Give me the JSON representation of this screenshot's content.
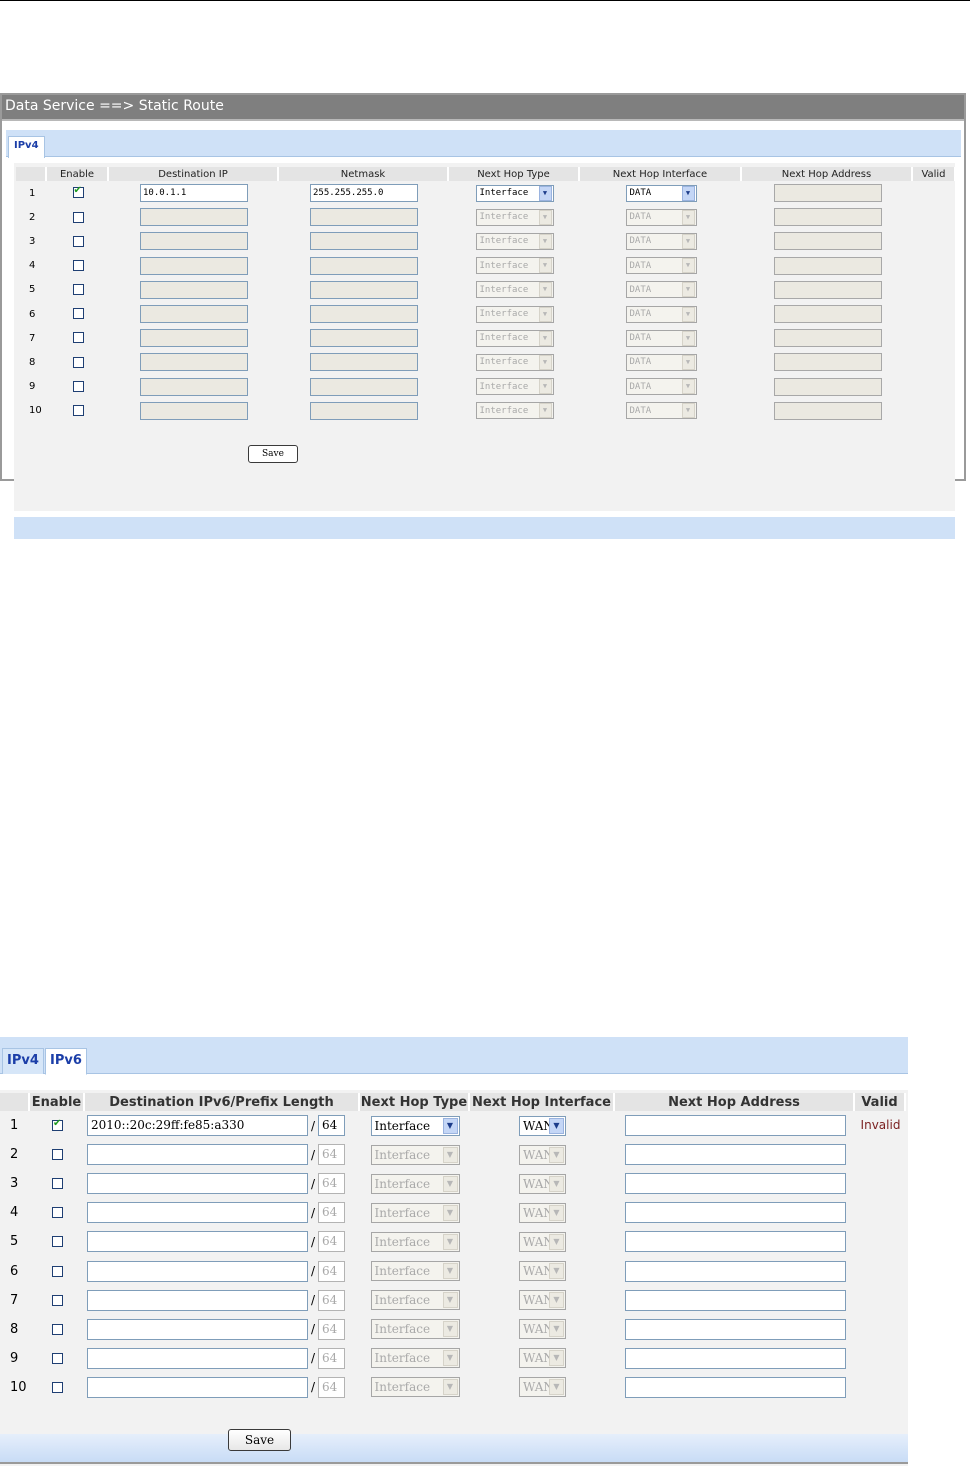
{
  "panel1": {
    "title": "Data Service ==> Static Route",
    "tab_ipv4": "IPv4",
    "headers": {
      "enable": "Enable",
      "dest": "Destination IP",
      "netmask": "Netmask",
      "hop_type": "Next Hop Type",
      "hop_if": "Next Hop Interface",
      "hop_addr": "Next Hop Address",
      "valid": "Valid"
    },
    "rows": [
      {
        "num": "1",
        "enabled": true,
        "dest": "10.0.1.1",
        "netmask": "255.255.255.0",
        "hop_type": "Interface",
        "hop_if": "DATA",
        "hop_addr": "",
        "valid": ""
      },
      {
        "num": "2",
        "enabled": false,
        "dest": "",
        "netmask": "",
        "hop_type": "Interface",
        "hop_if": "DATA",
        "hop_addr": "",
        "valid": ""
      },
      {
        "num": "3",
        "enabled": false,
        "dest": "",
        "netmask": "",
        "hop_type": "Interface",
        "hop_if": "DATA",
        "hop_addr": "",
        "valid": ""
      },
      {
        "num": "4",
        "enabled": false,
        "dest": "",
        "netmask": "",
        "hop_type": "Interface",
        "hop_if": "DATA",
        "hop_addr": "",
        "valid": ""
      },
      {
        "num": "5",
        "enabled": false,
        "dest": "",
        "netmask": "",
        "hop_type": "Interface",
        "hop_if": "DATA",
        "hop_addr": "",
        "valid": ""
      },
      {
        "num": "6",
        "enabled": false,
        "dest": "",
        "netmask": "",
        "hop_type": "Interface",
        "hop_if": "DATA",
        "hop_addr": "",
        "valid": ""
      },
      {
        "num": "7",
        "enabled": false,
        "dest": "",
        "netmask": "",
        "hop_type": "Interface",
        "hop_if": "DATA",
        "hop_addr": "",
        "valid": ""
      },
      {
        "num": "8",
        "enabled": false,
        "dest": "",
        "netmask": "",
        "hop_type": "Interface",
        "hop_if": "DATA",
        "hop_addr": "",
        "valid": ""
      },
      {
        "num": "9",
        "enabled": false,
        "dest": "",
        "netmask": "",
        "hop_type": "Interface",
        "hop_if": "DATA",
        "hop_addr": "",
        "valid": ""
      },
      {
        "num": "10",
        "enabled": false,
        "dest": "",
        "netmask": "",
        "hop_type": "Interface",
        "hop_if": "DATA",
        "hop_addr": "",
        "valid": ""
      }
    ],
    "save_label": "Save"
  },
  "panel2": {
    "tab_ipv4": "IPv4",
    "tab_ipv6": "IPv6",
    "headers": {
      "enable": "Enable",
      "dest": "Destination IPv6/Prefix Length",
      "hop_type": "Next Hop Type",
      "hop_if": "Next Hop Interface",
      "hop_addr": "Next Hop Address",
      "valid": "Valid"
    },
    "rows": [
      {
        "num": "1",
        "enabled": true,
        "dest": "2010::20c:29ff:fe85:a330",
        "prefix": "64",
        "hop_type": "Interface",
        "hop_if": "WAN",
        "hop_addr": "",
        "valid": "Invalid"
      },
      {
        "num": "2",
        "enabled": false,
        "dest": "",
        "prefix": "64",
        "hop_type": "Interface",
        "hop_if": "WAN",
        "hop_addr": "",
        "valid": ""
      },
      {
        "num": "3",
        "enabled": false,
        "dest": "",
        "prefix": "64",
        "hop_type": "Interface",
        "hop_if": "WAN",
        "hop_addr": "",
        "valid": ""
      },
      {
        "num": "4",
        "enabled": false,
        "dest": "",
        "prefix": "64",
        "hop_type": "Interface",
        "hop_if": "WAN",
        "hop_addr": "",
        "valid": ""
      },
      {
        "num": "5",
        "enabled": false,
        "dest": "",
        "prefix": "64",
        "hop_type": "Interface",
        "hop_if": "WAN",
        "hop_addr": "",
        "valid": ""
      },
      {
        "num": "6",
        "enabled": false,
        "dest": "",
        "prefix": "64",
        "hop_type": "Interface",
        "hop_if": "WAN",
        "hop_addr": "",
        "valid": ""
      },
      {
        "num": "7",
        "enabled": false,
        "dest": "",
        "prefix": "64",
        "hop_type": "Interface",
        "hop_if": "WAN",
        "hop_addr": "",
        "valid": ""
      },
      {
        "num": "8",
        "enabled": false,
        "dest": "",
        "prefix": "64",
        "hop_type": "Interface",
        "hop_if": "WAN",
        "hop_addr": "",
        "valid": ""
      },
      {
        "num": "9",
        "enabled": false,
        "dest": "",
        "prefix": "64",
        "hop_type": "Interface",
        "hop_if": "WAN",
        "hop_addr": "",
        "valid": ""
      },
      {
        "num": "10",
        "enabled": false,
        "dest": "",
        "prefix": "64",
        "hop_type": "Interface",
        "hop_if": "WAN",
        "hop_addr": "",
        "valid": ""
      }
    ],
    "save_label": "Save"
  },
  "colors": {
    "title_bar": "#7f7f7f",
    "tab_bar": "#cfe1f7",
    "tab_text": "#1b3ea8",
    "invalid_text": "#7a1f1f"
  },
  "icons": {
    "checkbox_checked": "checkmark-icon",
    "select_arrow": "chevron-down-icon"
  }
}
